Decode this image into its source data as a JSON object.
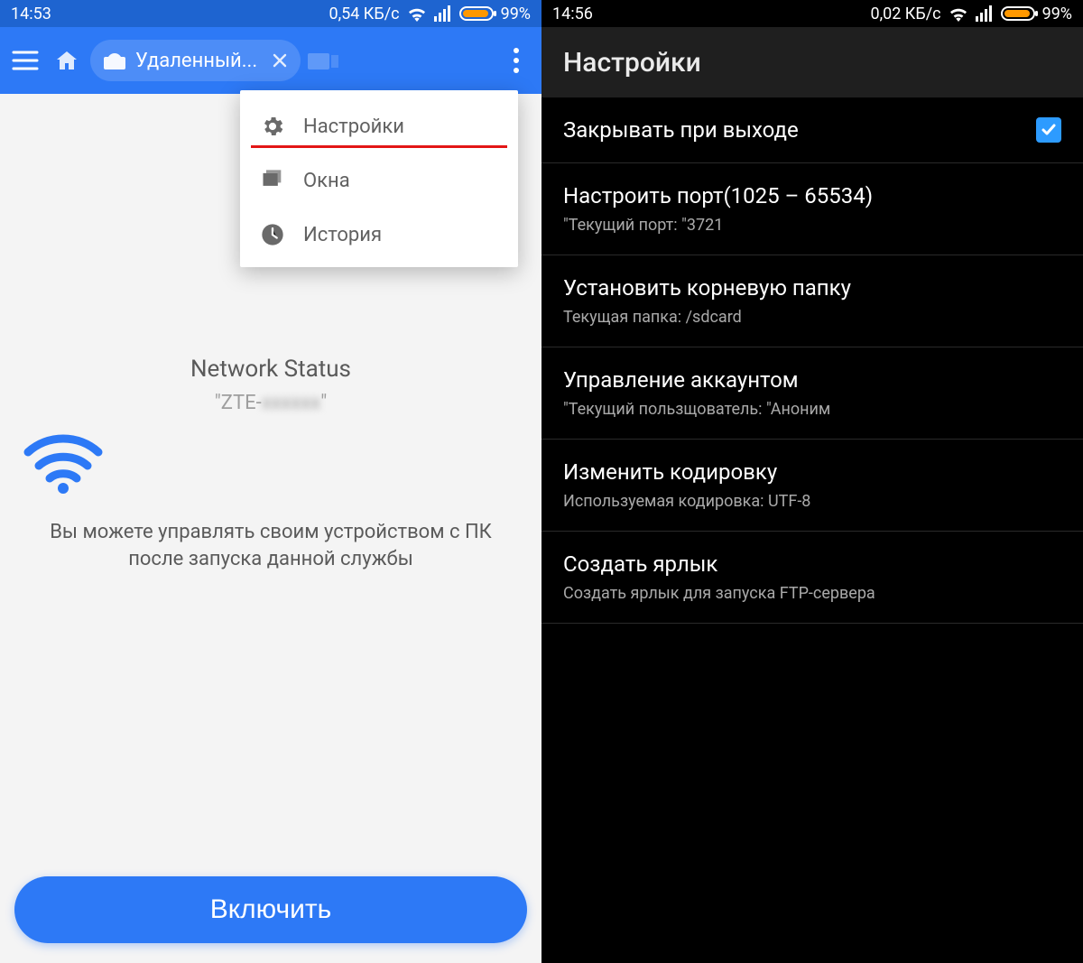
{
  "left": {
    "statusbar": {
      "time": "14:53",
      "speed": "0,54 КБ/с",
      "battery_pct": "99%"
    },
    "toolbar": {
      "tab_label": "Удаленный..."
    },
    "menu": {
      "items": [
        {
          "label": "Настройки"
        },
        {
          "label": "Окна"
        },
        {
          "label": "История"
        }
      ]
    },
    "main": {
      "network_status_title": "Network Status",
      "ssid_prefix": "\"ZTE-",
      "ssid_hidden": "xxxxxx",
      "ssid_suffix": "\"",
      "description_l1": "Вы можете управлять своим устройством с ПК",
      "description_l2": "после запуска данной службы"
    },
    "button": {
      "enable": "Включить"
    }
  },
  "right": {
    "statusbar": {
      "time": "14:56",
      "speed": "0,02 КБ/с",
      "battery_pct": "99%"
    },
    "title": "Настройки",
    "rows": [
      {
        "title": "Закрывать при выходе",
        "subtitle": "",
        "checkbox": true,
        "checked": true
      },
      {
        "title": "Настроить порт(1025 – 65534)",
        "subtitle": "\"Текущий порт: \"3721"
      },
      {
        "title": "Установить корневую папку",
        "subtitle": "Текущая папка: /sdcard"
      },
      {
        "title": "Управление аккаунтом",
        "subtitle": "\"Текущий пользщователь: \"Аноним"
      },
      {
        "title": "Изменить кодировку",
        "subtitle": "Используемая кодировка: UTF-8"
      },
      {
        "title": "Создать ярлык",
        "subtitle": "Создать ярлык для запуска FTP-сервера"
      }
    ]
  }
}
